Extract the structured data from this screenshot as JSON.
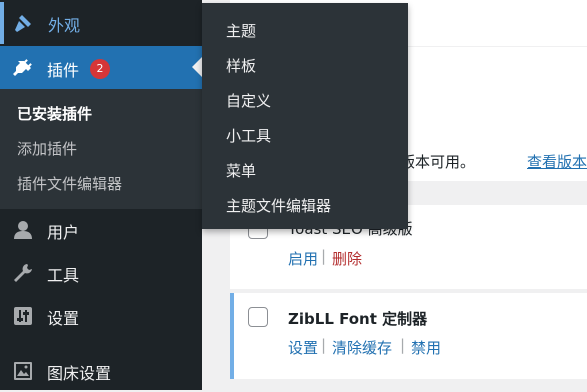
{
  "sidebar": {
    "appearance_label": "外观",
    "plugins_label": "插件",
    "plugins_badge": "2",
    "submenu": [
      "已安装插件",
      "添加插件",
      "插件文件编辑器"
    ],
    "items": [
      "用户",
      "工具",
      "设置",
      "图床设置"
    ]
  },
  "flyout": {
    "items": [
      "主题",
      "样板",
      "自定义",
      "小工具",
      "菜单",
      "主题文件编辑器"
    ]
  },
  "main": {
    "update_notice_text": "有新版本可用。",
    "update_notice_link": "查看版本",
    "row1": {
      "title": "Yoast SEO 高级版",
      "actions": [
        "启用",
        "删除"
      ]
    },
    "row2": {
      "title": "ZibLL Font 定制器",
      "actions": [
        "设置",
        "清除缓存",
        "禁用"
      ]
    }
  },
  "colors": {
    "sidebar_bg": "#1d2327",
    "active_blue": "#2271b1",
    "link_blue": "#2271b1",
    "delete_red": "#b32d2e",
    "badge_red": "#d63638"
  }
}
